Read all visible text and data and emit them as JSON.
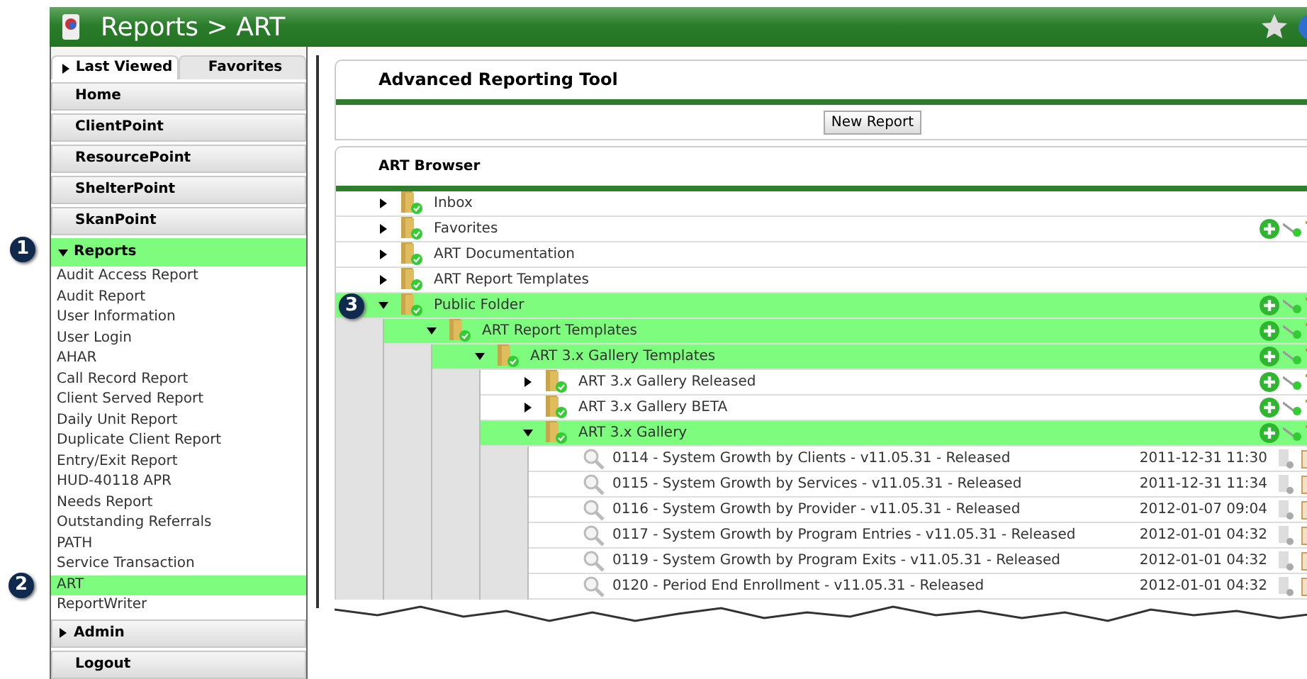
{
  "window": {
    "title": "Reports > ART"
  },
  "sidebar": {
    "tabs": [
      {
        "label": "Last Viewed",
        "selected": true
      },
      {
        "label": "Favorites",
        "selected": false
      }
    ],
    "nav": [
      "Home",
      "ClientPoint",
      "ResourcePoint",
      "ShelterPoint",
      "SkanPoint"
    ],
    "sections": [
      {
        "label": "Reports",
        "expanded": true,
        "callout": "1",
        "items": [
          {
            "label": "Audit Access Report",
            "selected": false
          },
          {
            "label": "Audit Report",
            "selected": false
          },
          {
            "label": "User Information",
            "selected": false
          },
          {
            "label": "User Login",
            "selected": false
          },
          {
            "label": "AHAR",
            "selected": false
          },
          {
            "label": "Call Record Report",
            "selected": false
          },
          {
            "label": "Client Served Report",
            "selected": false
          },
          {
            "label": "Daily Unit Report",
            "selected": false
          },
          {
            "label": "Duplicate Client Report",
            "selected": false
          },
          {
            "label": "Entry/Exit Report",
            "selected": false
          },
          {
            "label": "HUD-40118 APR",
            "selected": false
          },
          {
            "label": "Needs Report",
            "selected": false
          },
          {
            "label": "Outstanding Referrals",
            "selected": false
          },
          {
            "label": "PATH",
            "selected": false
          },
          {
            "label": "Service Transaction",
            "selected": false
          },
          {
            "label": "ART",
            "selected": true,
            "callout": "2"
          },
          {
            "label": "ReportWriter",
            "selected": false
          }
        ]
      },
      {
        "label": "Admin",
        "expanded": false
      }
    ],
    "footer": "Logout"
  },
  "main": {
    "title": "Advanced Reporting Tool",
    "new_button": "New Report",
    "browser": {
      "title": "ART Browser",
      "tree": [
        {
          "kind": "folder",
          "label": "Inbox",
          "expanded": false,
          "selected": false,
          "actions": false
        },
        {
          "kind": "folder",
          "label": "Favorites",
          "expanded": false,
          "selected": false,
          "actions": true
        },
        {
          "kind": "folder",
          "label": "ART Documentation",
          "expanded": false,
          "selected": false,
          "actions": false
        },
        {
          "kind": "folder",
          "label": "ART Report Templates",
          "expanded": false,
          "selected": false,
          "actions": false
        },
        {
          "kind": "folder",
          "label": "Public Folder",
          "expanded": true,
          "selected": true,
          "actions": true,
          "callout": "3",
          "children": [
            {
              "kind": "folder",
              "label": "ART Report Templates",
              "expanded": true,
              "selected": true,
              "actions": true,
              "children": [
                {
                  "kind": "folder",
                  "label": "ART 3.x Gallery Templates",
                  "expanded": true,
                  "selected": true,
                  "actions": true,
                  "children": [
                    {
                      "kind": "folder",
                      "label": "ART 3.x Gallery Released",
                      "expanded": false,
                      "selected": false,
                      "actions": true
                    },
                    {
                      "kind": "folder",
                      "label": "ART 3.x Gallery BETA",
                      "expanded": false,
                      "selected": false,
                      "actions": true
                    },
                    {
                      "kind": "folder",
                      "label": "ART 3.x Gallery",
                      "expanded": true,
                      "selected": true,
                      "actions": true,
                      "children": [
                        {
                          "kind": "report",
                          "label": "0114 - System Growth by Clients - v11.05.31 - Released",
                          "date": "2011-12-31 11:30"
                        },
                        {
                          "kind": "report",
                          "label": "0115 - System Growth by Services - v11.05.31 - Released",
                          "date": "2011-12-31 11:34"
                        },
                        {
                          "kind": "report",
                          "label": "0116 - System Growth by Provider - v11.05.31 - Released",
                          "date": "2012-01-07 09:04"
                        },
                        {
                          "kind": "report",
                          "label": "0117 - System Growth by Program Entries - v11.05.31 - Released",
                          "date": "2012-01-01 04:32"
                        },
                        {
                          "kind": "report",
                          "label": "0119 - System Growth by Program Exits - v11.05.31 - Released",
                          "date": "2012-01-01 04:32"
                        },
                        {
                          "kind": "report",
                          "label": "0120 - Period End Enrollment - v11.05.31 - Released",
                          "date": "2012-01-01 04:32"
                        }
                      ]
                    }
                  ]
                }
              ]
            }
          ]
        }
      ]
    }
  }
}
